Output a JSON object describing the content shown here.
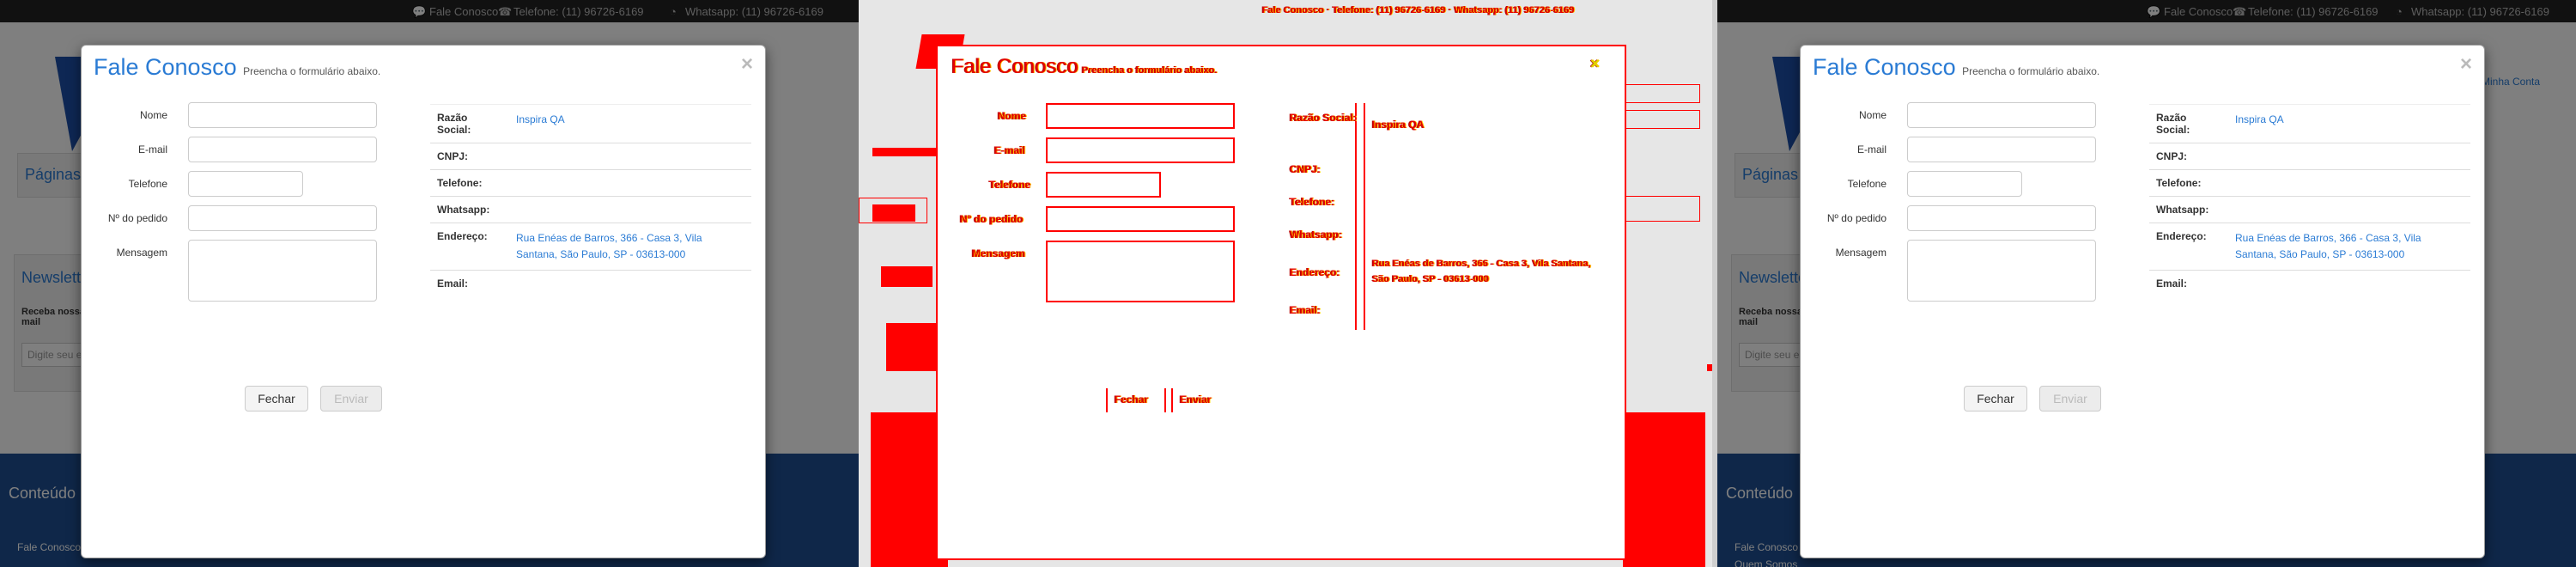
{
  "topbar": {
    "contact_link": "Fale Conosco",
    "phone": "Telefone: (11) 96726-6169",
    "whatsapp": "Whatsapp: (11) 96726-6169",
    "chat_link": "Minha Conta"
  },
  "site": {
    "breadcrumb": "Páginas",
    "newsletter_title": "Newsletter",
    "newsletter_label": "Receba nossas ofertas por e-mail",
    "newsletter_placeholder": "Digite seu e-mail",
    "footer_title": "Conteúdo",
    "footer_link_1": "Fale Conosco",
    "footer_link_2": "Quem Somos"
  },
  "modal": {
    "title": "Fale Conosco",
    "subtitle": "Preencha o formulário abaixo.",
    "close_glyph": "×",
    "fields": {
      "name_label": "Nome",
      "email_label": "E-mail",
      "phone_label": "Telefone",
      "order_label": "Nº do pedido",
      "message_label": "Mensagem"
    },
    "info": [
      {
        "key": "Razão Social:",
        "value": "Inspira QA"
      },
      {
        "key": "CNPJ:",
        "value": ""
      },
      {
        "key": "Telefone:",
        "value": ""
      },
      {
        "key": "Whatsapp:",
        "value": ""
      },
      {
        "key": "Endereço:",
        "value": "Rua Enéas de Barros, 366 - Casa 3, Vila Santana, São Paulo, SP - 03613-000"
      },
      {
        "key": "Email:",
        "value": ""
      }
    ],
    "buttons": {
      "close_label": "Fechar",
      "send_label": "Enviar"
    }
  },
  "colors": {
    "accent": "#2a7bd4",
    "diff": "#ff0000",
    "footer": "#1e4f93"
  }
}
